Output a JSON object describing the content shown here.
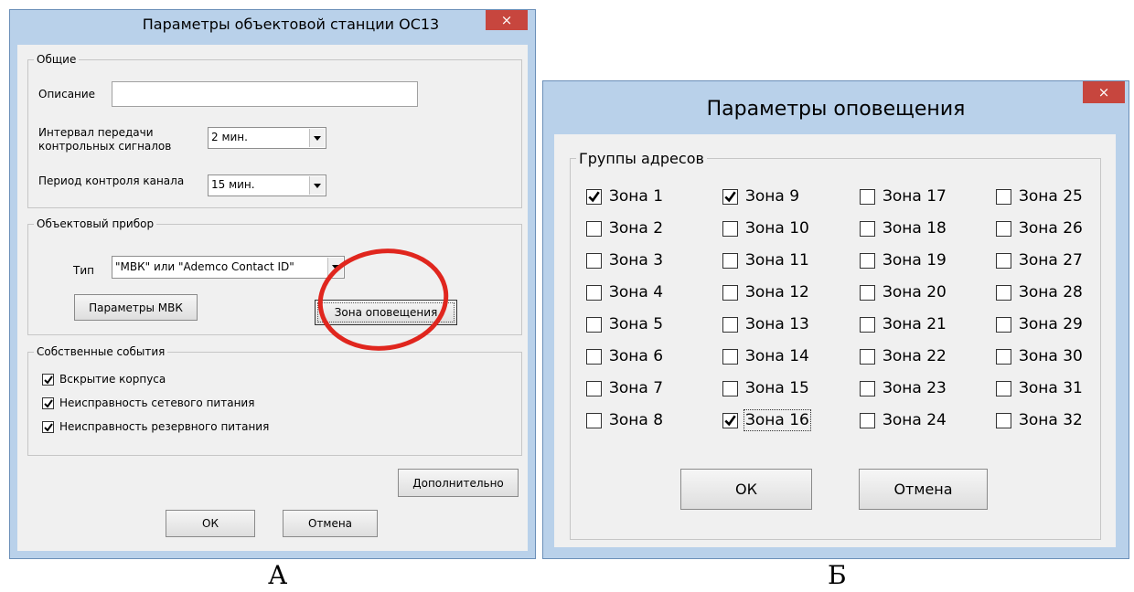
{
  "dialog_a": {
    "title": "Параметры объектовой станции ОС13",
    "close_glyph": "×",
    "general": {
      "group_label": "Общие",
      "description_label": "Описание",
      "description_value": "",
      "interval_label_line1": "Интервал передачи",
      "interval_label_line2": "контрольных сигналов",
      "interval_value": "2 мин.",
      "period_label": "Период контроля канала",
      "period_value": "15 мин."
    },
    "device": {
      "group_label": "Объектовый прибор",
      "type_label": "Тип",
      "type_value": "\"МВК\" или \"Ademco Contact ID\"",
      "mvk_button": "Параметры МВК",
      "zone_button": "Зона оповещения"
    },
    "own_events": {
      "group_label": "Собственные события",
      "items": [
        {
          "label": "Вскрытие корпуса",
          "checked": true
        },
        {
          "label": "Неисправность сетевого питания",
          "checked": true
        },
        {
          "label": "Неисправность резервного питания",
          "checked": true
        }
      ]
    },
    "extra_button": "Дополнительно",
    "ok_button": "ОК",
    "cancel_button": "Отмена"
  },
  "dialog_b": {
    "title": "Параметры оповещения",
    "close_glyph": "×",
    "group_label": "Группы адресов",
    "zones": [
      {
        "label": "Зона 1",
        "checked": true
      },
      {
        "label": "Зона 2",
        "checked": false
      },
      {
        "label": "Зона 3",
        "checked": false
      },
      {
        "label": "Зона 4",
        "checked": false
      },
      {
        "label": "Зона 5",
        "checked": false
      },
      {
        "label": "Зона 6",
        "checked": false
      },
      {
        "label": "Зона 7",
        "checked": false
      },
      {
        "label": "Зона 8",
        "checked": false
      },
      {
        "label": "Зона 9",
        "checked": true
      },
      {
        "label": "Зона 10",
        "checked": false
      },
      {
        "label": "Зона 11",
        "checked": false
      },
      {
        "label": "Зона 12",
        "checked": false
      },
      {
        "label": "Зона 13",
        "checked": false
      },
      {
        "label": "Зона 14",
        "checked": false
      },
      {
        "label": "Зона 15",
        "checked": false
      },
      {
        "label": "Зона 16",
        "checked": true
      },
      {
        "label": "Зона 17",
        "checked": false
      },
      {
        "label": "Зона 18",
        "checked": false
      },
      {
        "label": "Зона 19",
        "checked": false
      },
      {
        "label": "Зона 20",
        "checked": false
      },
      {
        "label": "Зона 21",
        "checked": false
      },
      {
        "label": "Зона 22",
        "checked": false
      },
      {
        "label": "Зона 23",
        "checked": false
      },
      {
        "label": "Зона 24",
        "checked": false
      },
      {
        "label": "Зона 25",
        "checked": false
      },
      {
        "label": "Зона 26",
        "checked": false
      },
      {
        "label": "Зона 27",
        "checked": false
      },
      {
        "label": "Зона 28",
        "checked": false
      },
      {
        "label": "Зона 29",
        "checked": false
      },
      {
        "label": "Зона 30",
        "checked": false
      },
      {
        "label": "Зона 31",
        "checked": false
      },
      {
        "label": "Зона 32",
        "checked": false
      }
    ],
    "ok_button": "ОК",
    "cancel_button": "Отмена"
  },
  "captions": {
    "a": "А",
    "b": "Б"
  },
  "colors": {
    "frame": "#b9d1ea",
    "close_button": "#c7463e",
    "highlight_ellipse": "#e0261e"
  }
}
